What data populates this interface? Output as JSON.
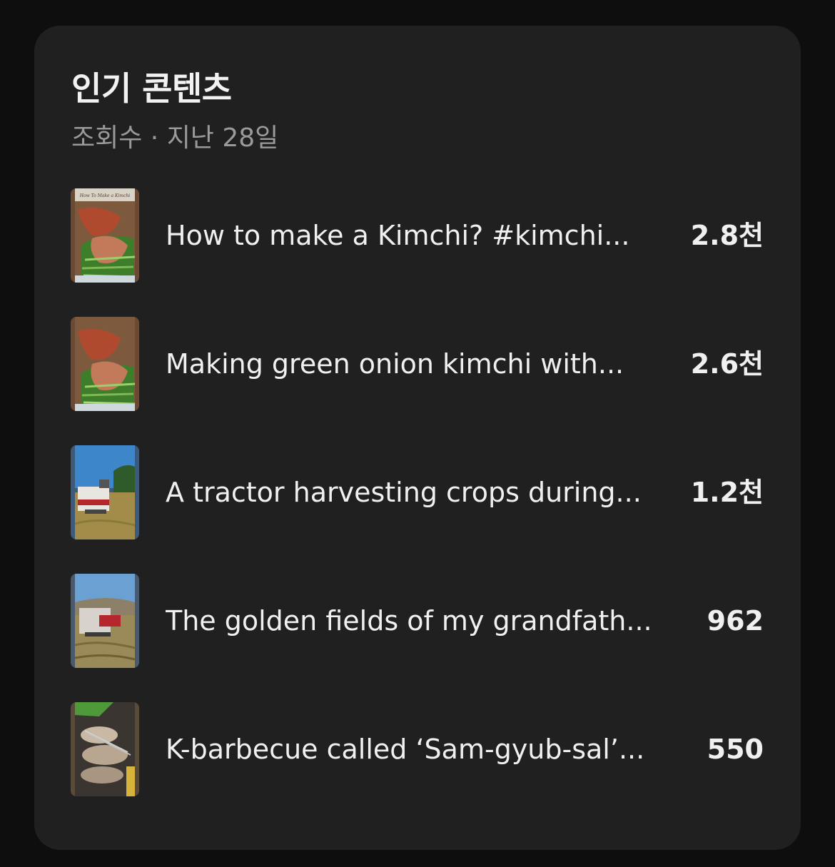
{
  "card": {
    "title": "인기 콘텐츠",
    "subtitle": "조회수 · 지난 28일"
  },
  "items": [
    {
      "title": "How to make a Kimchi?  #kimchi...",
      "views": "2.8천",
      "thumbnail": "kimchi-thumbnail",
      "thumbnail_caption": "How To Make a Kimchi"
    },
    {
      "title": "Making green onion kimchi with...",
      "views": "2.6천",
      "thumbnail": "kimchi-thumbnail"
    },
    {
      "title": "A tractor harvesting crops during...",
      "views": "1.2천",
      "thumbnail": "tractor-thumbnail"
    },
    {
      "title": "The golden fields of my grandfath...",
      "views": "962",
      "thumbnail": "harvester-field-thumbnail"
    },
    {
      "title": "K-barbecue called ‘Sam-gyub-sal’...",
      "views": "550",
      "thumbnail": "barbecue-thumbnail"
    }
  ],
  "colors": {
    "background": "#0e0e0e",
    "card": "#202020",
    "primary_text": "#f0f0f0",
    "secondary_text": "#9a9a9a"
  }
}
